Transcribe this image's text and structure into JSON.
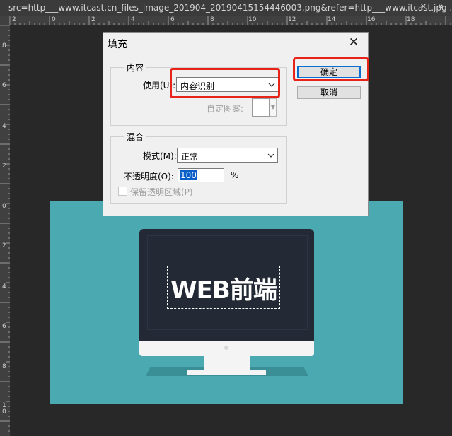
{
  "tab": {
    "title": "src=http___www.itcast.cn_files_image_201904_20190415154446003.png&refer=http___www.itcast.jpg ...",
    "close_glyph": "×",
    "more_glyph": "»"
  },
  "rulers": {
    "horizontal_labels": [
      "2",
      "0",
      "2",
      "4",
      "6",
      "8",
      "10",
      "12",
      "14",
      "16",
      "18"
    ],
    "vertical_labels": [
      "8",
      "6",
      "4",
      "2",
      "0",
      "2",
      "4",
      "6",
      "8",
      "1\n0"
    ]
  },
  "canvas": {
    "screen_text": "WEB前端",
    "background_color": "#4aa9b1"
  },
  "dialog": {
    "title": "填充",
    "close_glyph": "✕",
    "content_group": {
      "label": "内容",
      "use_label": "使用(U):",
      "use_value": "内容识别",
      "custom_pattern_label": "自定图案:"
    },
    "blend_group": {
      "label": "混合",
      "mode_label": "模式(M):",
      "mode_value": "正常",
      "opacity_label": "不透明度(O):",
      "opacity_value": "100",
      "opacity_unit": "%",
      "preserve_label": "保留透明区域(P)"
    },
    "buttons": {
      "ok": "确定",
      "cancel": "取消"
    }
  },
  "colors": {
    "highlight": "#e8231a",
    "accent_blue": "#0a6ed1"
  }
}
